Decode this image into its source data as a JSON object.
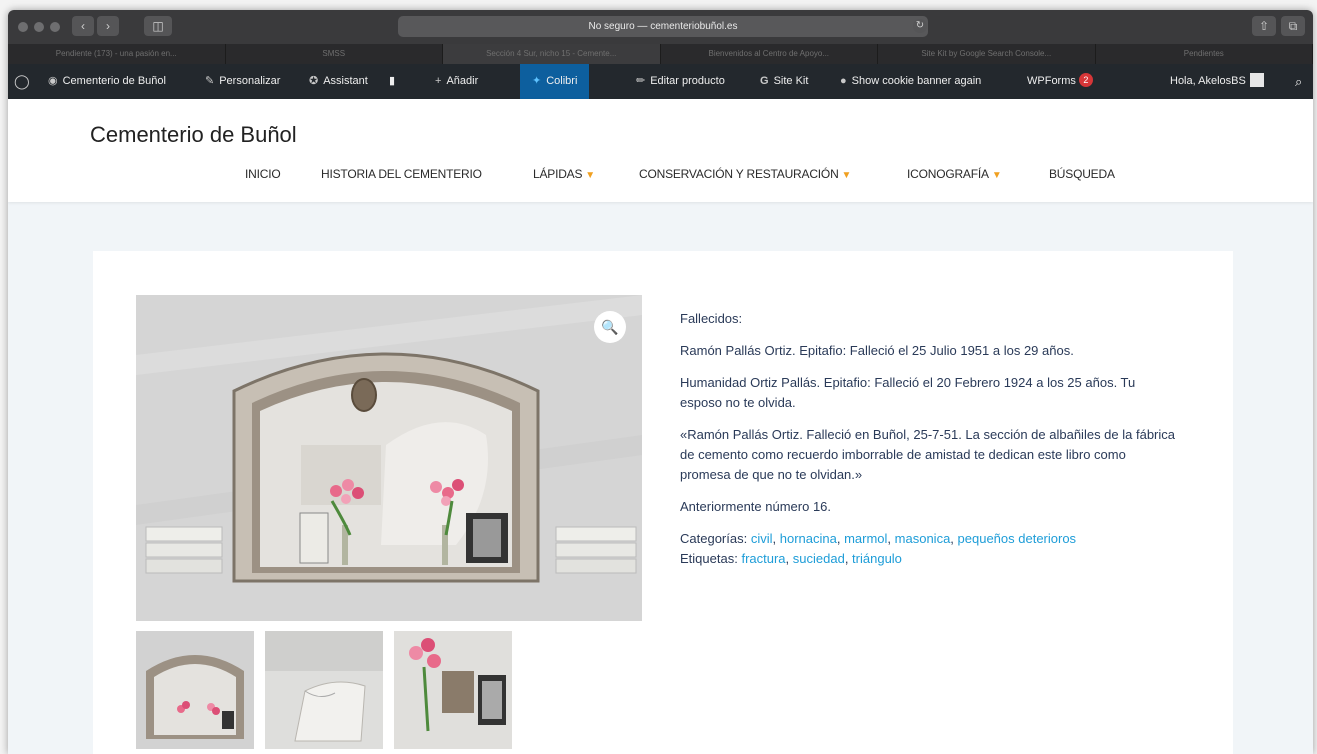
{
  "browser": {
    "address": "No seguro — cementeriobuñol.es",
    "tabs": [
      "Pendiente (173) - una pasión en...",
      "SMSS",
      "Sección 4 Sur, nicho 15 - Cemente...",
      "Bienvenidos al Centro de Apoyo...",
      "Site Kit by Google Search Console...",
      "Pendientes"
    ]
  },
  "adminbar": {
    "site": "Cementerio de Buñol",
    "customize": "Personalizar",
    "assistant": "Assistant",
    "add": "Añadir",
    "colibri": "Colibri",
    "edit": "Editar producto",
    "sitekit": "Site Kit",
    "cookie": "Show cookie banner again",
    "wpforms": "WPForms",
    "wpforms_count": "2",
    "greeting": "Hola, AkelosBS"
  },
  "header": {
    "title": "Cementerio de Buñol",
    "menu": [
      "INICIO",
      "HISTORIA DEL CEMENTERIO",
      "LÁPIDAS",
      "CONSERVACIÓN Y RESTAURACIÓN",
      "ICONOGRAFÍA",
      "BÚSQUEDA"
    ]
  },
  "product": {
    "deceased_label": "Fallecidos:",
    "line1": "Ramón Pallás Ortiz. Epitafio: Falleció el 25 Julio 1951 a los 29 años.",
    "line2": "Humanidad Ortiz Pallás. Epitafio: Falleció el 20 Febrero 1924 a los 25 años. Tu esposo no te olvida.",
    "line3": "«Ramón Pallás Ortiz. Falleció en Buñol, 25-7-51. La sección de albañiles de la fábrica de cemento como recuerdo imborrable de amistad te dedican este libro como promesa de que no te olvidan.»",
    "line4": "Anteriormente número 16.",
    "categories_label": "Categorías:",
    "categories": [
      "civil",
      "hornacina",
      "marmol",
      "masonica",
      "pequeños deterioros"
    ],
    "tags_label": "Etiquetas:",
    "tags": [
      "fractura",
      "suciedad",
      "triángulo"
    ]
  },
  "colors": {
    "admin_bg": "#23282d",
    "link": "#1e9dd8",
    "menu_chevron": "#f0a020",
    "text": "#2a3a58"
  }
}
